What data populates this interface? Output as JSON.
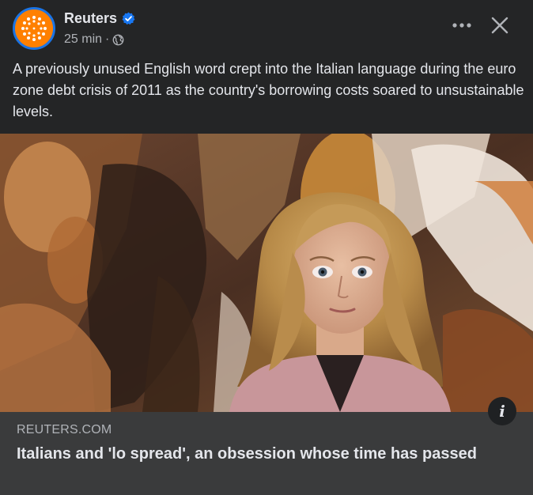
{
  "post": {
    "page_name": "Reuters",
    "time": "25 min",
    "separator": "·",
    "audience_icon": "globe-icon",
    "verified_icon": "verified-badge-icon",
    "more_icon": "more-horizontal-icon",
    "close_icon": "close-icon",
    "text": "A previously unused English word crept into the Italian language during the euro zone debt crisis of 2011 as the country's borrowing costs soared to unsustainable levels."
  },
  "link": {
    "domain": "REUTERS.COM",
    "title": "Italians and 'lo spread', an obsession whose time has passed",
    "info_icon": "info-icon",
    "info_glyph": "i"
  },
  "colors": {
    "background": "#242526",
    "footer": "#3a3b3c",
    "text_primary": "#e4e6eb",
    "text_secondary": "#b0b3b8",
    "verified": "#1877f2",
    "avatar_orange": "#ff8000"
  }
}
